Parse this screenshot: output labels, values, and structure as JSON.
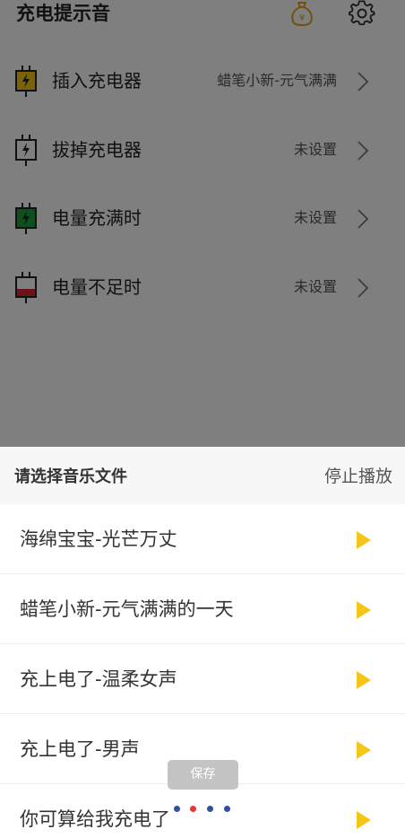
{
  "app": {
    "title": "充电提示音",
    "settings": [
      {
        "label": "插入充电器",
        "value": "蜡笔小新-元气满满",
        "icon": "plug-charging-icon"
      },
      {
        "label": "拔掉充电器",
        "value": "未设置",
        "icon": "plug-unplug-icon"
      },
      {
        "label": "电量充满时",
        "value": "未设置",
        "icon": "plug-full-icon"
      },
      {
        "label": "电量不足时",
        "value": "未设置",
        "icon": "plug-low-icon"
      }
    ]
  },
  "sheet": {
    "title": "请选择音乐文件",
    "stop_label": "停止播放",
    "tracks": [
      {
        "name": "海绵宝宝-光芒万丈"
      },
      {
        "name": "蜡笔小新-元气满满的一天"
      },
      {
        "name": "充上电了-温柔女声"
      },
      {
        "name": "充上电了-男声"
      },
      {
        "name": "你可算给我充电了"
      }
    ]
  },
  "toast": {
    "label": "保存"
  },
  "colors": {
    "accent_yellow": "#f5c518",
    "charging_yellow": "#f2c40f",
    "full_green": "#1f9e3a",
    "low_red": "#d8262e",
    "dot_blue": "#2f4fa0",
    "dot_red": "#e0383c"
  }
}
